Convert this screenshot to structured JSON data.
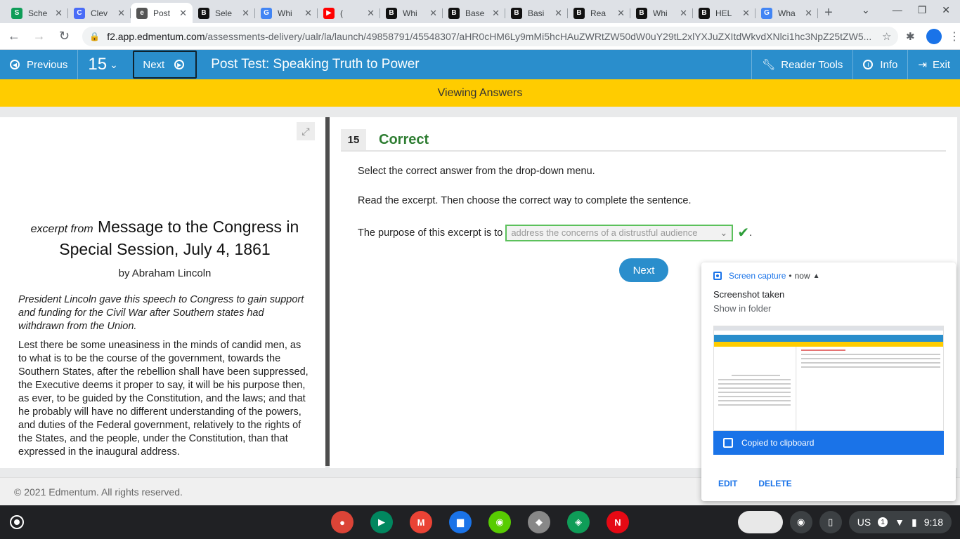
{
  "browser": {
    "tabs": [
      {
        "title": "Sche",
        "fav": "S",
        "color": "#0f9d58"
      },
      {
        "title": "Clev",
        "fav": "C",
        "color": "#4a6cf7"
      },
      {
        "title": "Post",
        "fav": "e",
        "color": "#555555",
        "active": true
      },
      {
        "title": "Sele",
        "fav": "B",
        "color": "#111111"
      },
      {
        "title": "Whi",
        "fav": "G",
        "color": "#4285f4"
      },
      {
        "title": "(",
        "fav": "▶",
        "color": "#ff0000"
      },
      {
        "title": "Whi",
        "fav": "B",
        "color": "#111111"
      },
      {
        "title": "Base",
        "fav": "B",
        "color": "#111111"
      },
      {
        "title": "Basi",
        "fav": "B",
        "color": "#111111"
      },
      {
        "title": "Rea",
        "fav": "B",
        "color": "#111111"
      },
      {
        "title": "Whi",
        "fav": "B",
        "color": "#111111"
      },
      {
        "title": "HEL",
        "fav": "B",
        "color": "#111111"
      },
      {
        "title": "Wha",
        "fav": "G",
        "color": "#4285f4"
      }
    ],
    "url_host": "f2.app.edmentum.com",
    "url_rest": "/assessments-delivery/ualr/la/launch/49858791/45548307/aHR0cHM6Ly9mMi5hcHAuZWRtZW50dW0uY29tL2xlYXJuZXItdWkvdXNlci1hc3NpZ25tZW5..."
  },
  "header": {
    "previous_label": "Previous",
    "question_number": "15",
    "next_label": "Next",
    "title": "Post Test: Speaking Truth to Power",
    "reader_tools": "Reader Tools",
    "info": "Info",
    "exit": "Exit"
  },
  "banner": "Viewing Answers",
  "passage": {
    "pre_title": "excerpt from",
    "title": "Message to the Congress in Special Session, July 4, 1861",
    "author": "by Abraham Lincoln",
    "intro": "President Lincoln gave this speech to Congress to gain support and funding for the Civil War after Southern states had withdrawn from the Union.",
    "body": "Lest there be some uneasiness in the minds of candid men, as to what is to be the course of the government, towards the Southern States, after the rebellion shall have been suppressed, the Executive deems it proper to say, it will be his purpose then, as ever, to be guided by the Constitution, and the laws; and that he probably will have no different understanding of the powers, and duties of the Federal government, relatively to the rights of the States, and the people, under the Constitution, than that expressed in the inaugural address."
  },
  "question": {
    "number": "15",
    "status": "Correct",
    "instruction": "Select the correct answer from the drop-down menu.",
    "prompt": "Read the excerpt. Then choose the correct way to complete the sentence.",
    "sentence_start": "The purpose of this excerpt is to",
    "selected_answer": "address the concerns of a distrustful audience",
    "sentence_end": ".",
    "next_label": "Next"
  },
  "footer": "© 2021 Edmentum. All rights reserved.",
  "notification": {
    "app": "Screen capture",
    "time": "now",
    "title": "Screenshot taken",
    "subtitle": "Show in folder",
    "clipboard": "Copied to clipboard",
    "edit": "EDIT",
    "delete": "DELETE"
  },
  "shelf": {
    "apps": [
      {
        "name": "chrome",
        "glyph": "●",
        "color": "#db4437"
      },
      {
        "name": "play-store",
        "glyph": "▶",
        "color": "#01875f"
      },
      {
        "name": "gmail",
        "glyph": "M",
        "color": "#ea4335"
      },
      {
        "name": "files",
        "glyph": "▆",
        "color": "#1a73e8"
      },
      {
        "name": "duolingo",
        "glyph": "◉",
        "color": "#58cc02"
      },
      {
        "name": "roblox",
        "glyph": "◆",
        "color": "#888888"
      },
      {
        "name": "sheets-app",
        "glyph": "◈",
        "color": "#0f9d58"
      },
      {
        "name": "netflix",
        "glyph": "N",
        "color": "#e50914"
      }
    ],
    "locale": "US",
    "notif_count": "1",
    "time": "9:18"
  }
}
